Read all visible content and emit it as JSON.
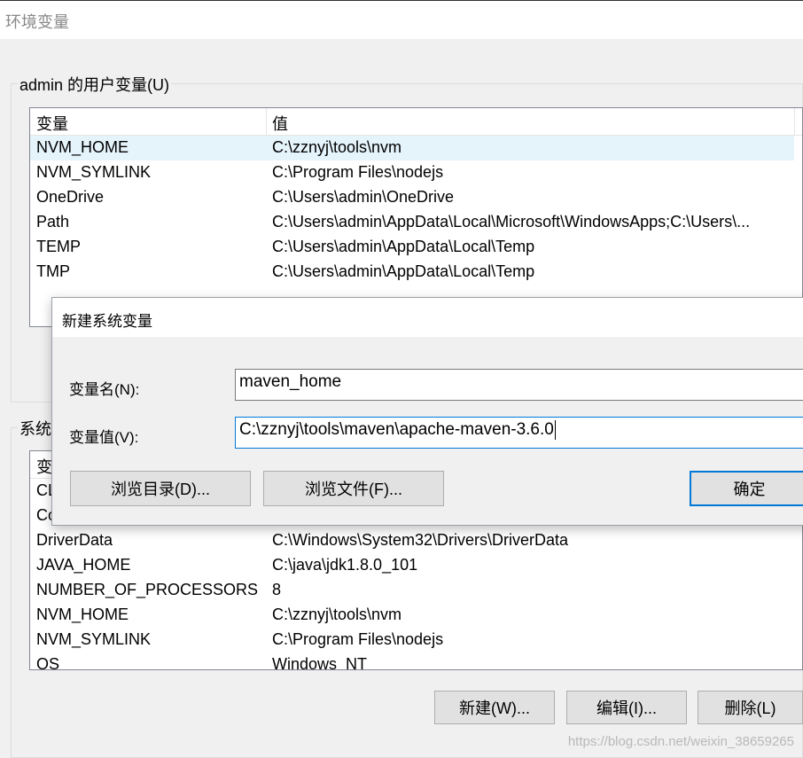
{
  "window": {
    "title": "环境变量"
  },
  "user_vars": {
    "label": "admin 的用户变量(U)",
    "columns": [
      "变量",
      "值"
    ],
    "rows": [
      {
        "name": "NVM_HOME",
        "value": "C:\\zznyj\\tools\\nvm",
        "selected": true
      },
      {
        "name": "NVM_SYMLINK",
        "value": "C:\\Program Files\\nodejs"
      },
      {
        "name": "OneDrive",
        "value": "C:\\Users\\admin\\OneDrive"
      },
      {
        "name": "Path",
        "value": "C:\\Users\\admin\\AppData\\Local\\Microsoft\\WindowsApps;C:\\Users\\..."
      },
      {
        "name": "TEMP",
        "value": "C:\\Users\\admin\\AppData\\Local\\Temp"
      },
      {
        "name": "TMP",
        "value": "C:\\Users\\admin\\AppData\\Local\\Temp"
      }
    ]
  },
  "system_vars": {
    "label_visible": "系统",
    "header_partial": "变",
    "rows": [
      {
        "name": "CL",
        "value": ""
      },
      {
        "name": "Co",
        "value": ""
      },
      {
        "name": "DriverData",
        "value": "C:\\Windows\\System32\\Drivers\\DriverData"
      },
      {
        "name": "JAVA_HOME",
        "value": "C:\\java\\jdk1.8.0_101"
      },
      {
        "name": "NUMBER_OF_PROCESSORS",
        "value": "8"
      },
      {
        "name": "NVM_HOME",
        "value": "C:\\zznyj\\tools\\nvm"
      },
      {
        "name": "NVM_SYMLINK",
        "value": "C:\\Program Files\\nodejs"
      },
      {
        "name": "OS",
        "value": "Windows_NT"
      }
    ],
    "buttons": {
      "new": "新建(W)...",
      "edit": "编辑(I)...",
      "delete": "删除(L)"
    }
  },
  "dialog": {
    "title": "新建系统变量",
    "name_label": "变量名(N):",
    "name_value": "maven_home",
    "value_label": "变量值(V):",
    "value_value": "C:\\zznyj\\tools\\maven\\apache-maven-3.6.0",
    "browse_dir": "浏览目录(D)...",
    "browse_file": "浏览文件(F)...",
    "ok": "确定"
  },
  "watermark": "https://blog.csdn.net/weixin_38659265"
}
